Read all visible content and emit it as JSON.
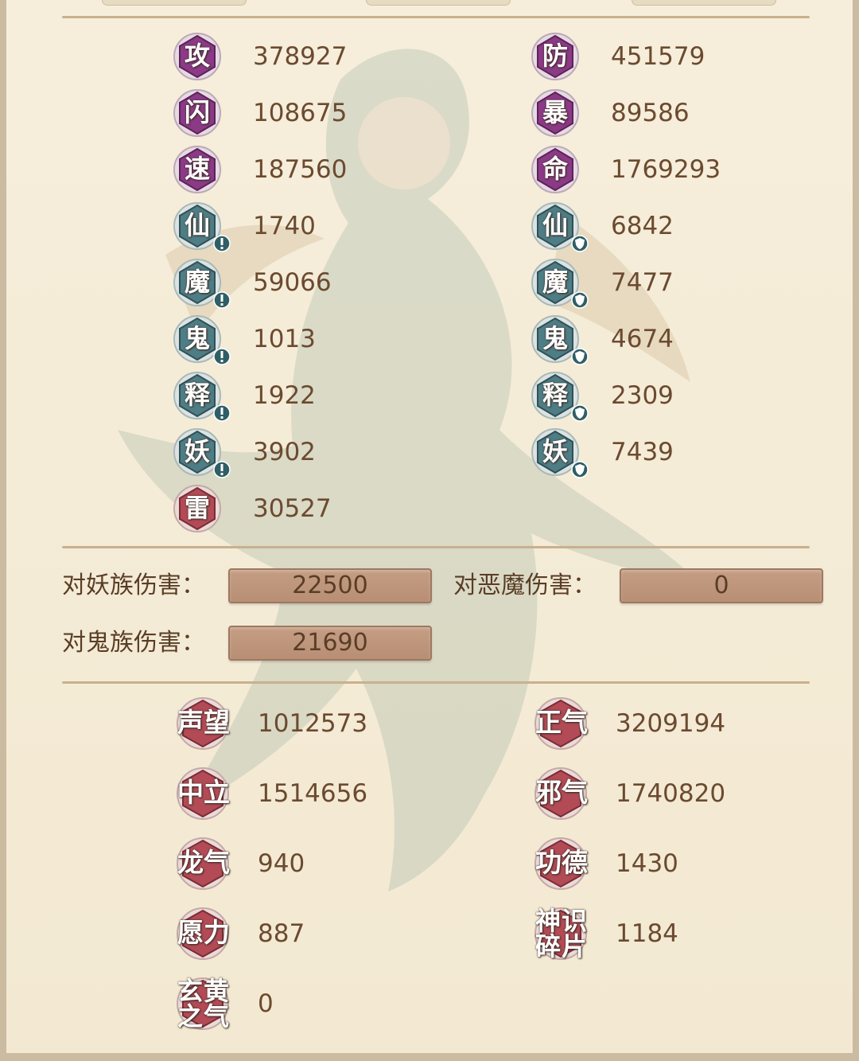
{
  "colors": {
    "purple_badge": "#8b3a86",
    "teal_badge": "#4f7d85",
    "red_badge": "#b24b56",
    "value_text": "#6b4a30",
    "field_bg": "#c19b81"
  },
  "core_stats": [
    {
      "name": "攻",
      "value": "378927",
      "kind": "purple"
    },
    {
      "name": "防",
      "value": "451579",
      "kind": "purple"
    },
    {
      "name": "闪",
      "value": "108675",
      "kind": "purple"
    },
    {
      "name": "暴",
      "value": "89586",
      "kind": "purple"
    },
    {
      "name": "速",
      "value": "187560",
      "kind": "purple"
    },
    {
      "name": "命",
      "value": "1769293",
      "kind": "purple"
    }
  ],
  "element_attack": [
    {
      "name": "仙",
      "value": "1740",
      "marker": "attack-icon"
    },
    {
      "name": "魔",
      "value": "59066",
      "marker": "attack-icon"
    },
    {
      "name": "鬼",
      "value": "1013",
      "marker": "attack-icon"
    },
    {
      "name": "释",
      "value": "1922",
      "marker": "attack-icon"
    },
    {
      "name": "妖",
      "value": "3902",
      "marker": "attack-icon"
    }
  ],
  "element_defense": [
    {
      "name": "仙",
      "value": "6842",
      "marker": "shield-icon"
    },
    {
      "name": "魔",
      "value": "7477",
      "marker": "shield-icon"
    },
    {
      "name": "鬼",
      "value": "4674",
      "marker": "shield-icon"
    },
    {
      "name": "释",
      "value": "2309",
      "marker": "shield-icon"
    },
    {
      "name": "妖",
      "value": "7439",
      "marker": "shield-icon"
    }
  ],
  "thunder": {
    "name": "雷",
    "value": "30527"
  },
  "damage_bonus": {
    "demon_race_label": "对妖族伤害：",
    "demon_race_value": "22500",
    "evil_demon_label": "对恶魔伤害：",
    "evil_demon_value": "0",
    "ghost_race_label": "对鬼族伤害：",
    "ghost_race_value": "21690"
  },
  "reputation": [
    {
      "name": "声望",
      "value": "1012573"
    },
    {
      "name": "正气",
      "value": "3209194"
    },
    {
      "name": "中立",
      "value": "1514656"
    },
    {
      "name": "邪气",
      "value": "1740820"
    },
    {
      "name": "龙气",
      "value": "940"
    },
    {
      "name": "功德",
      "value": "1430"
    },
    {
      "name": "愿力",
      "value": "887"
    },
    {
      "name": "神识碎片",
      "value": "1184"
    },
    {
      "name": "玄黄之气",
      "value": "0"
    }
  ]
}
